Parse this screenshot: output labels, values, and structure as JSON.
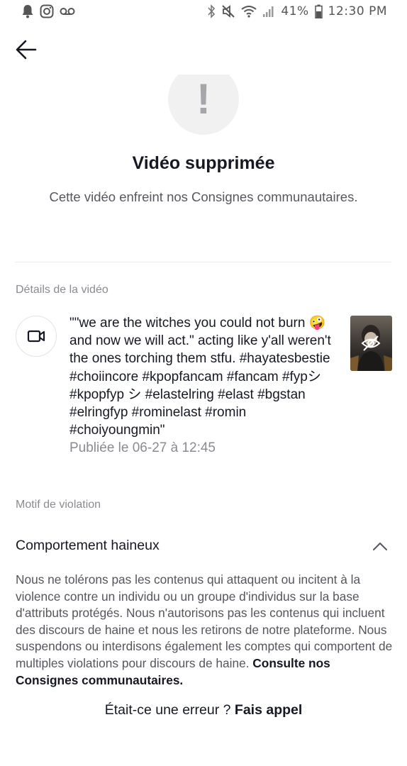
{
  "status_bar": {
    "icons_left": [
      "bell-icon",
      "instagram-icon",
      "voicemail-icon"
    ],
    "icons_right": [
      "bluetooth-icon",
      "mute-icon",
      "wifi-icon",
      "signal-icon",
      "battery-icon"
    ],
    "battery": "41%",
    "time": "12:30 PM"
  },
  "header": {
    "title": "Vidéo supprimée",
    "subtitle": "Cette vidéo enfreint nos Consignes communautaires."
  },
  "video_details": {
    "label": "Détails de la vidéo",
    "description": "\"\"we are the witches you could not burn 🤪 and now we will act.\" acting like y'all weren't the ones torching them stfu. #hayatesbestie #choiincore #kpopfancam #fancam #fypシ #kpopfyp シ #elastelring #elast #bgstan #elringfyp #rominelast #romin #choiyoungmin\"",
    "date": "Publiée le 06-27 à 12:45"
  },
  "violation": {
    "label": "Motif de violation",
    "reason": "Comportement haineux",
    "policy_text": "Nous ne tolérons pas les contenus qui attaquent ou incitent à la violence contre un individu ou un groupe d'individus sur la base d'attributs protégés. Nous n'autorisons pas les contenus qui incluent des discours de haine et nous les retirons de notre plateforme. Nous suspendons ou interdisons également les comptes qui comportent de multiples violations pour discours de haine.",
    "policy_link": "Consulte nos Consignes communautaires."
  },
  "appeal": {
    "question": "Était-ce une erreur ?",
    "link": "Fais appel"
  },
  "colors": {
    "text_primary": "#161823",
    "text_secondary": "#8a8b91",
    "alert_bg": "#f1f1f2"
  }
}
